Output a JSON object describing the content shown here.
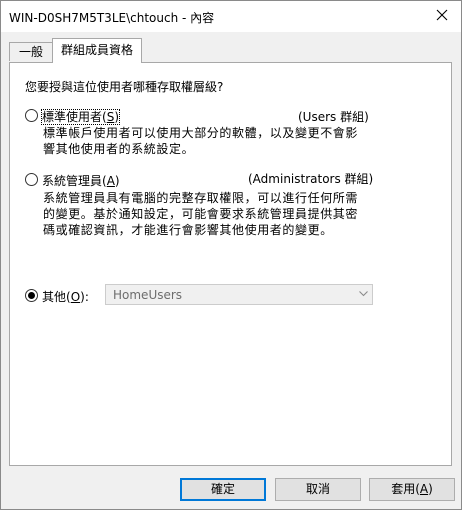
{
  "window": {
    "title": "WIN-D0SH7M5T3LE\\chtouch - 內容"
  },
  "tabs": [
    {
      "label": "一般",
      "selected": false
    },
    {
      "label": "群組成員資格",
      "selected": true
    }
  ],
  "panel": {
    "question": "您要授與這位使用者哪種存取權層級?",
    "options": [
      {
        "label": "標準使用者",
        "mnemonic": "S",
        "group": "(Users 群組)",
        "description": "標準帳戶使用者可以使用大部分的軟體，以及變更不會影響其他使用者的系統設定。",
        "selected": false
      },
      {
        "label": "系統管理員",
        "mnemonic": "A",
        "group": "(Administrators 群組)",
        "description": "系統管理員具有電腦的完整存取權限，可以進行任何所需的變更。基於通知設定，可能會要求系統管理員提供其密碼或確認資訊，才能進行會影響其他使用者的變更。",
        "selected": false
      },
      {
        "label": "其他",
        "mnemonic": "O",
        "suffix": ":",
        "selected": true
      }
    ],
    "other_combo": {
      "value": "HomeUsers"
    }
  },
  "buttons": {
    "ok": "確定",
    "cancel": "取消",
    "apply_label": "套用",
    "apply_mnemonic": "A"
  }
}
